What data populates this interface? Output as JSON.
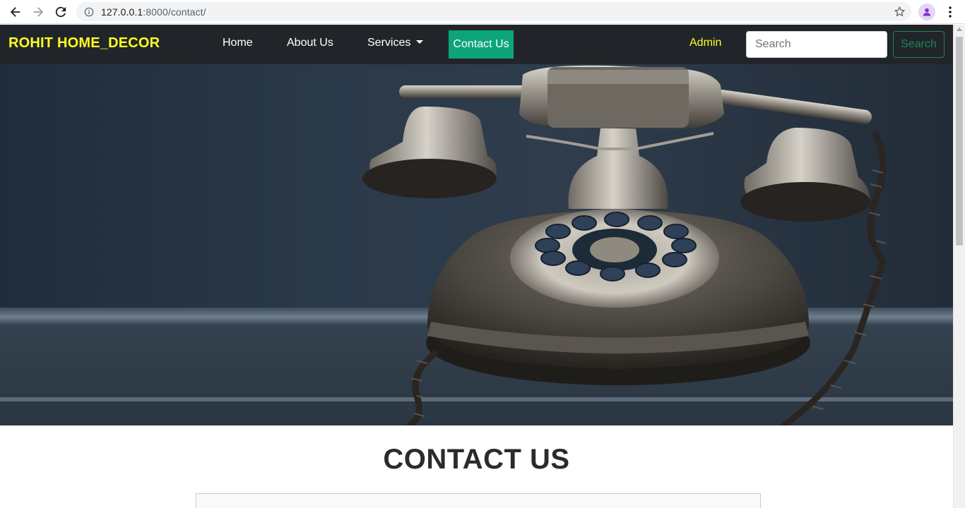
{
  "browser": {
    "url_host": "127.0.0.1",
    "url_path": ":8000/contact/"
  },
  "navbar": {
    "brand": "ROHIT HOME_DECOR",
    "links": [
      {
        "label": "Home"
      },
      {
        "label": "About Us"
      },
      {
        "label": "Services"
      },
      {
        "label": "Contact Us"
      }
    ],
    "admin_label": "Admin",
    "search_placeholder": "Search",
    "search_button": "Search"
  },
  "main": {
    "title": "CONTACT US"
  },
  "colors": {
    "brand": "#ffff26",
    "navbar_bg": "#212529",
    "active_tab": "#0ea47a",
    "search_button": "#198754"
  },
  "icons": {
    "back": "arrow-left-icon",
    "forward": "arrow-right-icon",
    "reload": "reload-icon",
    "info": "info-icon",
    "bookmark": "star-icon",
    "profile": "profile-icon",
    "menu": "kebab-menu-icon"
  }
}
